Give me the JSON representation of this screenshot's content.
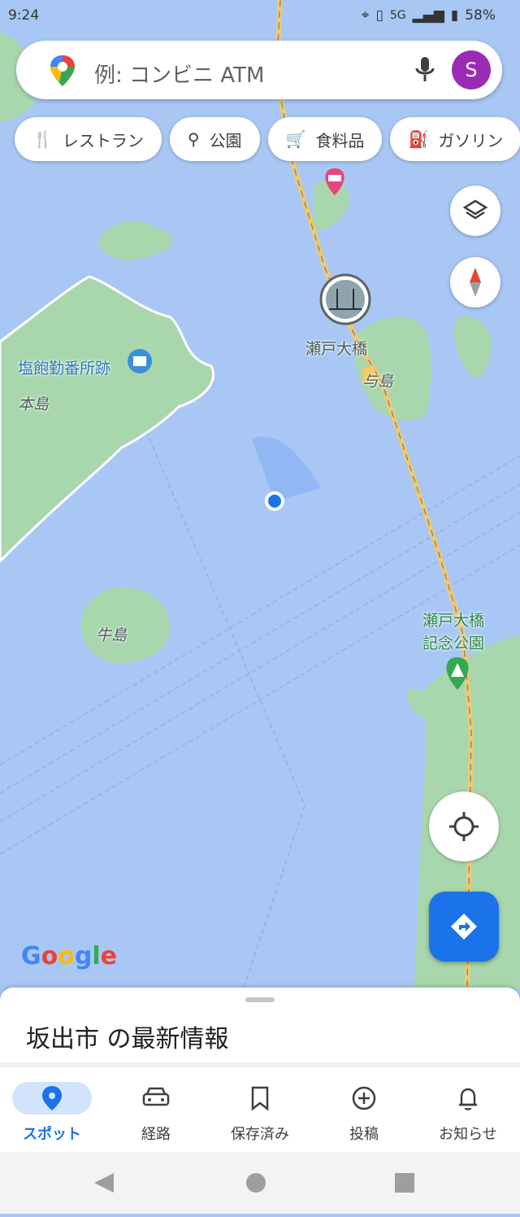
{
  "status_bar": {
    "time": "9:24",
    "network": "5G",
    "battery": "58%"
  },
  "search": {
    "placeholder": "例: コンビニ ATM",
    "avatar_initial": "S"
  },
  "chips": [
    "レストラン",
    "公園",
    "食料品",
    "ガソリン"
  ],
  "map_labels": {
    "seto_ohashi": "瀬戸大橋",
    "yoshima": "与島",
    "shiwaku": "塩飽勤番所跡",
    "honjima": "本島",
    "ushijima": "牛島",
    "memorial_park_1": "瀬戸大橋",
    "memorial_park_2": "記念公園",
    "google": "Google"
  },
  "sheet": {
    "title": "坂出市 の最新情報"
  },
  "bottom_nav": [
    {
      "label": "スポット",
      "icon": "location-pin-icon",
      "active": true
    },
    {
      "label": "経路",
      "icon": "car-icon"
    },
    {
      "label": "保存済み",
      "icon": "bookmark-icon"
    },
    {
      "label": "投稿",
      "icon": "add-circle-icon"
    },
    {
      "label": "お知らせ",
      "icon": "bell-icon"
    }
  ],
  "colors": {
    "water": "#a8c7f4",
    "land": "#a8d7ae",
    "accent": "#1a73e8",
    "avatar": "#9b2bb4"
  }
}
